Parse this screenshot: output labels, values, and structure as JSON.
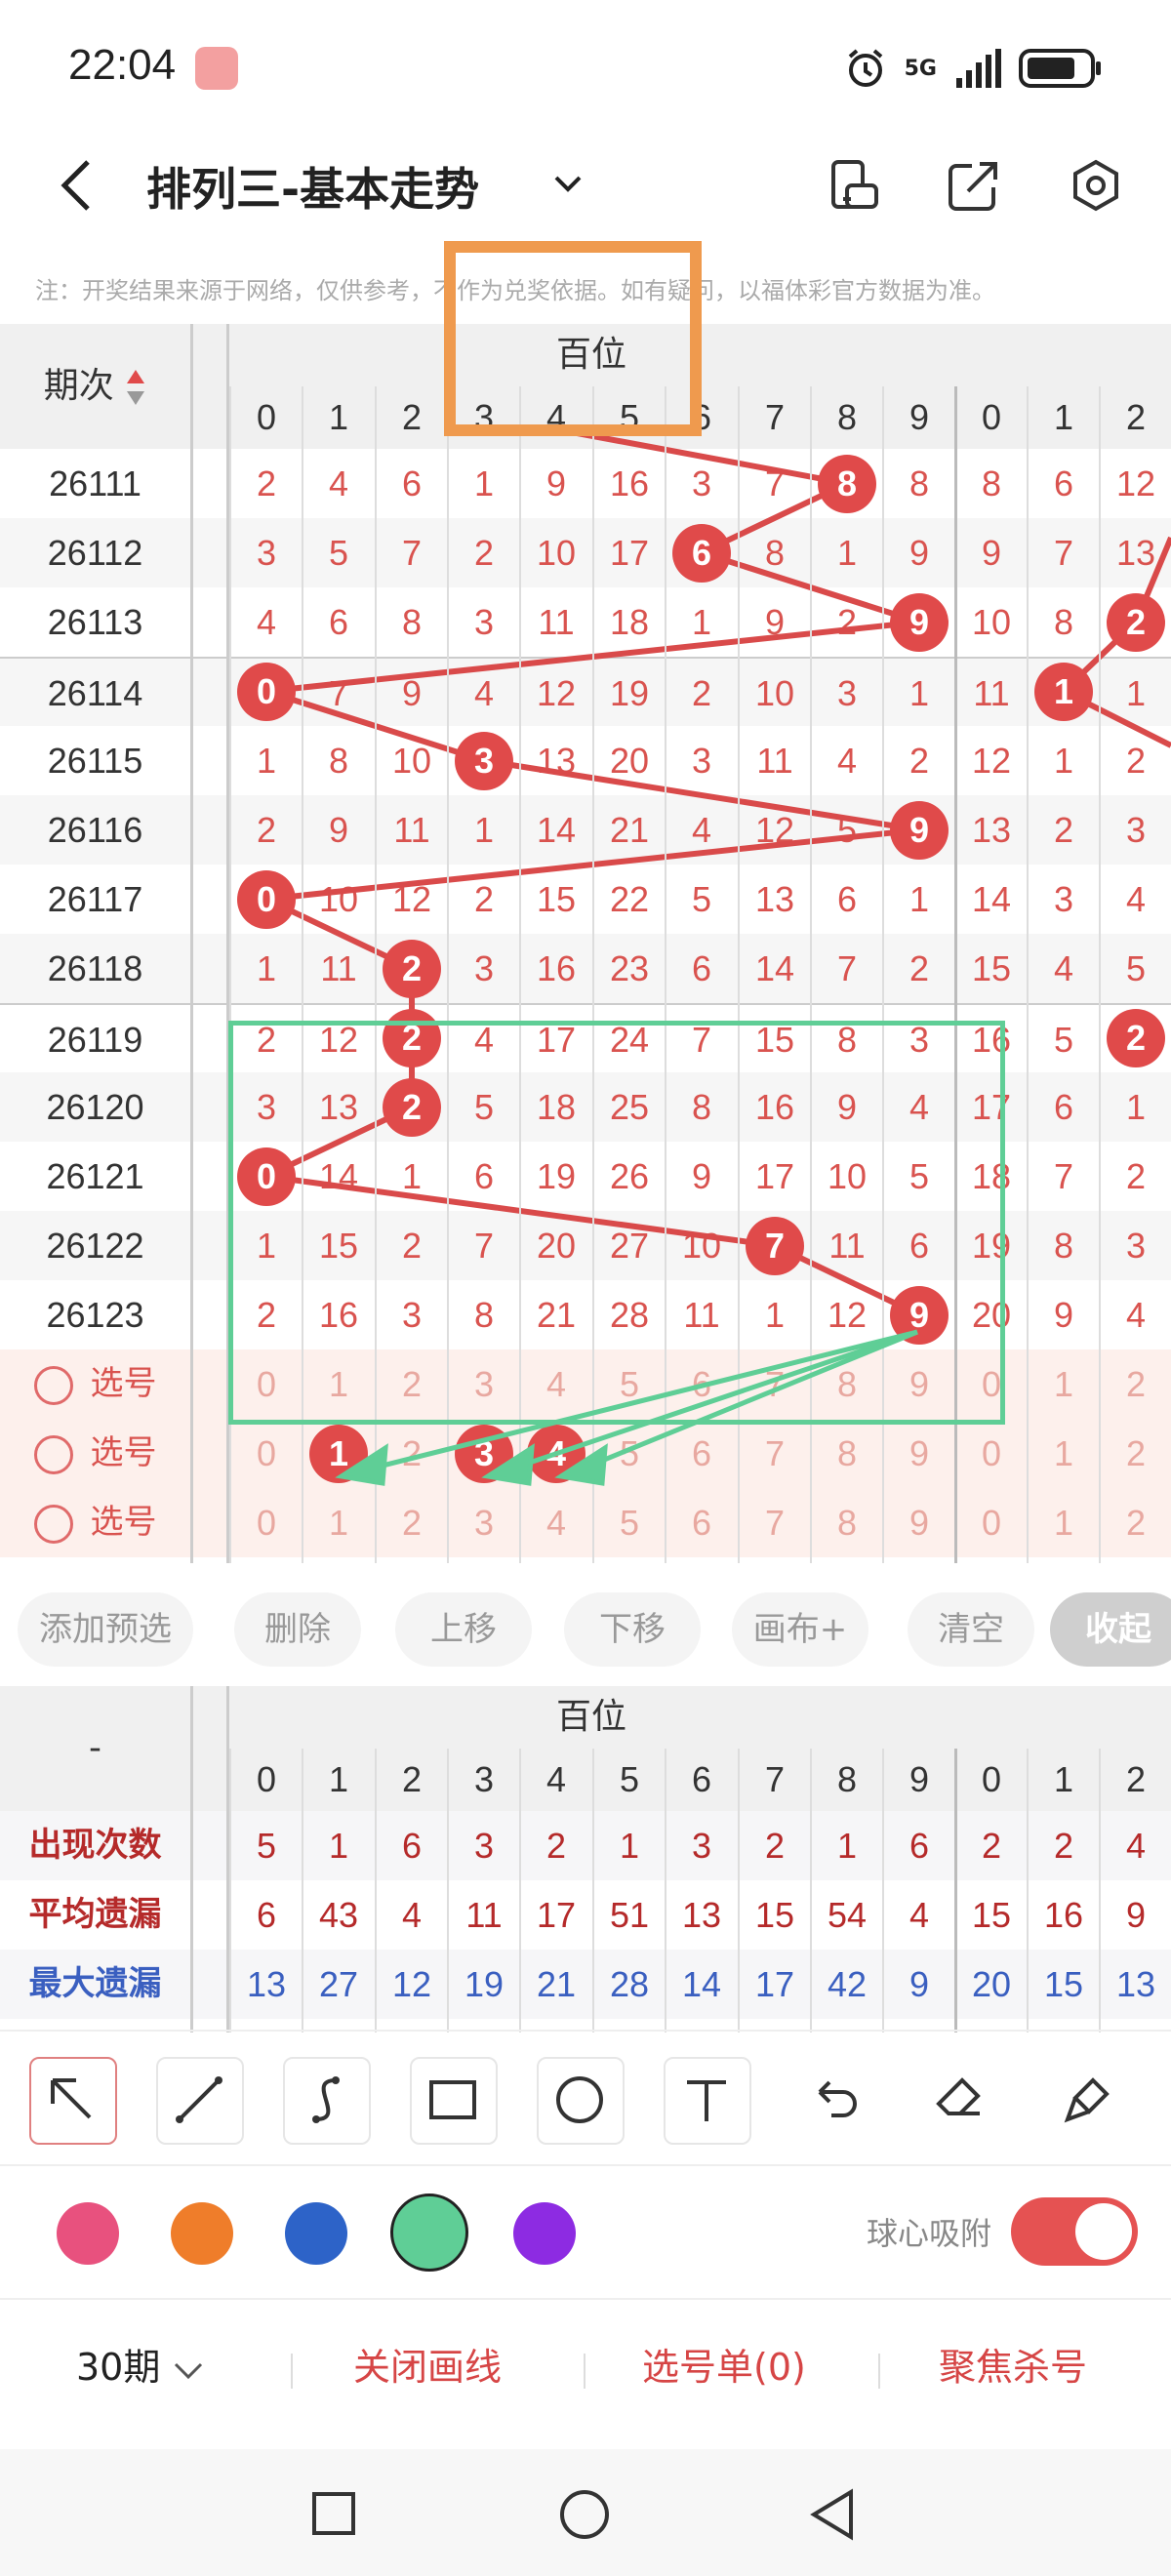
{
  "status": {
    "time": "22:04",
    "network": "5G"
  },
  "header": {
    "title": "排列三-基本走势"
  },
  "note": "注：开奖结果来源于网络，仅供参考，不作为兑奖依据。如有疑问，以福体彩官方数据为准。",
  "table": {
    "issue_header": "期次",
    "group_label": "百位",
    "digits": [
      "0",
      "1",
      "2",
      "3",
      "4",
      "5",
      "6",
      "7",
      "8",
      "9"
    ],
    "next_digits": [
      "0",
      "1",
      "2"
    ],
    "rows": [
      {
        "issue": "26111",
        "vals": [
          "2",
          "4",
          "6",
          "1",
          "9",
          "16",
          "3",
          "7",
          "8",
          "8"
        ],
        "hit": 8,
        "next": [
          "8",
          "6",
          "12"
        ],
        "nhit": -1
      },
      {
        "issue": "26112",
        "vals": [
          "3",
          "5",
          "7",
          "2",
          "10",
          "17",
          "6",
          "8",
          "1",
          "9"
        ],
        "hit": 6,
        "next": [
          "9",
          "7",
          "13"
        ],
        "nhit": -1
      },
      {
        "issue": "26113",
        "vals": [
          "4",
          "6",
          "8",
          "3",
          "11",
          "18",
          "1",
          "9",
          "2",
          "9"
        ],
        "hit": 9,
        "next": [
          "10",
          "8",
          "2"
        ],
        "nhit": 2
      },
      {
        "issue": "26114",
        "vals": [
          "0",
          "7",
          "9",
          "4",
          "12",
          "19",
          "2",
          "10",
          "3",
          "1"
        ],
        "hit": 0,
        "next": [
          "11",
          "1",
          "1"
        ],
        "nhit": 1
      },
      {
        "issue": "26115",
        "vals": [
          "1",
          "8",
          "10",
          "3",
          "13",
          "20",
          "3",
          "11",
          "4",
          "2"
        ],
        "hit": 3,
        "next": [
          "12",
          "1",
          "2"
        ],
        "nhit": -1
      },
      {
        "issue": "26116",
        "vals": [
          "2",
          "9",
          "11",
          "1",
          "14",
          "21",
          "4",
          "12",
          "5",
          "9"
        ],
        "hit": 9,
        "next": [
          "13",
          "2",
          "3"
        ],
        "nhit": -1
      },
      {
        "issue": "26117",
        "vals": [
          "0",
          "10",
          "12",
          "2",
          "15",
          "22",
          "5",
          "13",
          "6",
          "1"
        ],
        "hit": 0,
        "next": [
          "14",
          "3",
          "4"
        ],
        "nhit": -1
      },
      {
        "issue": "26118",
        "vals": [
          "1",
          "11",
          "2",
          "3",
          "16",
          "23",
          "6",
          "14",
          "7",
          "2"
        ],
        "hit": 2,
        "next": [
          "15",
          "4",
          "5"
        ],
        "nhit": -1
      },
      {
        "issue": "26119",
        "vals": [
          "2",
          "12",
          "2",
          "4",
          "17",
          "24",
          "7",
          "15",
          "8",
          "3"
        ],
        "hit": 2,
        "next": [
          "16",
          "5",
          "2"
        ],
        "nhit": 2
      },
      {
        "issue": "26120",
        "vals": [
          "3",
          "13",
          "2",
          "5",
          "18",
          "25",
          "8",
          "16",
          "9",
          "4"
        ],
        "hit": 2,
        "next": [
          "17",
          "6",
          "1"
        ],
        "nhit": -1
      },
      {
        "issue": "26121",
        "vals": [
          "0",
          "14",
          "1",
          "6",
          "19",
          "26",
          "9",
          "17",
          "10",
          "5"
        ],
        "hit": 0,
        "next": [
          "18",
          "7",
          "2"
        ],
        "nhit": -1
      },
      {
        "issue": "26122",
        "vals": [
          "1",
          "15",
          "2",
          "7",
          "20",
          "27",
          "10",
          "7",
          "11",
          "6"
        ],
        "hit": 7,
        "next": [
          "19",
          "8",
          "3"
        ],
        "nhit": -1
      },
      {
        "issue": "26123",
        "vals": [
          "2",
          "16",
          "3",
          "8",
          "21",
          "28",
          "11",
          "1",
          "12",
          "9"
        ],
        "hit": 9,
        "next": [
          "20",
          "9",
          "4"
        ],
        "nhit": -1
      }
    ],
    "select_label": "选号",
    "select_rows": [
      {
        "vals": [
          "0",
          "1",
          "2",
          "3",
          "4",
          "5",
          "6",
          "7",
          "8",
          "9"
        ],
        "next": [
          "0",
          "1",
          "2"
        ],
        "hits": []
      },
      {
        "vals": [
          "0",
          "1",
          "2",
          "3",
          "4",
          "5",
          "6",
          "7",
          "8",
          "9"
        ],
        "next": [
          "0",
          "1",
          "2"
        ],
        "hits": [
          1,
          3,
          4
        ]
      },
      {
        "vals": [
          "0",
          "1",
          "2",
          "3",
          "4",
          "5",
          "6",
          "7",
          "8",
          "9"
        ],
        "next": [
          "0",
          "1",
          "2"
        ],
        "hits": []
      }
    ]
  },
  "actions": [
    "添加预选",
    "删除",
    "上移",
    "下移",
    "画布+",
    "清空",
    "收起"
  ],
  "stats": {
    "dash": "-",
    "group_label": "百位",
    "rows": [
      {
        "label": "出现次数",
        "color": "#b52a2a",
        "vals": [
          "5",
          "1",
          "6",
          "3",
          "2",
          "1",
          "3",
          "2",
          "1",
          "6",
          "2",
          "2",
          "4"
        ]
      },
      {
        "label": "平均遗漏",
        "color": "#b52a2a",
        "vals": [
          "6",
          "43",
          "4",
          "11",
          "17",
          "51",
          "13",
          "15",
          "54",
          "4",
          "15",
          "16",
          "9"
        ]
      },
      {
        "label": "最大遗漏",
        "color": "#3a5fc0",
        "vals": [
          "13",
          "27",
          "12",
          "19",
          "21",
          "28",
          "14",
          "17",
          "42",
          "9",
          "20",
          "15",
          "13"
        ]
      }
    ]
  },
  "tools": [
    "arrow-tool-icon",
    "line-tool-icon",
    "curve-tool-icon",
    "rectangle-tool-icon",
    "circle-tool-icon",
    "text-tool-icon",
    "undo-icon",
    "eraser-icon",
    "clear-brush-icon"
  ],
  "palette": [
    "#e8517e",
    "#ef7d2a",
    "#2d63c8",
    "#5fce96",
    "#8d2be2"
  ],
  "snap_label": "球心吸附",
  "snap_on": true,
  "bottom": {
    "period": "30期",
    "close_draw": "关闭画线",
    "pick_list": "选号单(0)",
    "focus_kill": "聚焦杀号"
  }
}
